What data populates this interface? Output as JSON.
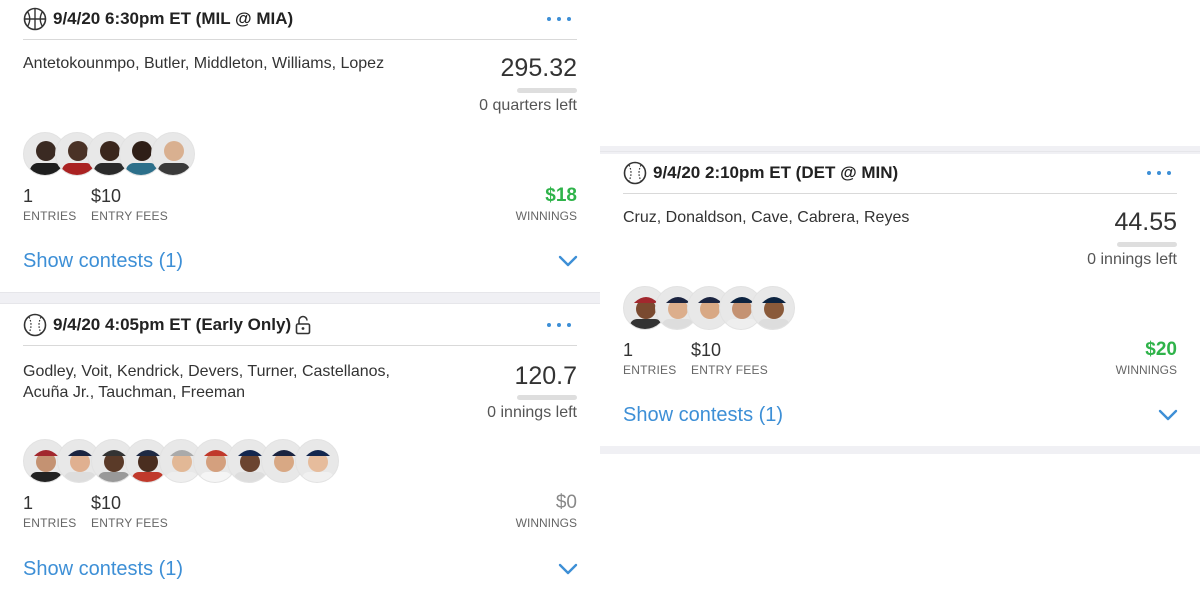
{
  "colors": {
    "accent": "#3d8fd6",
    "win_green": "#2fb34a",
    "zero_gray": "#888888"
  },
  "cards": [
    {
      "sport_icon": "basketball-icon",
      "title": "9/4/20 6:30pm ET (MIL @ MIA)",
      "players": "Antetokounmpo, Butler, Middleton, Williams, Lopez",
      "score": "295.32",
      "remaining": "0 quarters left",
      "entries": "1",
      "entries_label": "ENTRIES",
      "fees": "$10",
      "fees_label": "ENTRY FEES",
      "winnings": "$18",
      "winnings_label": "WINNINGS",
      "show_contests": "Show contests (1)"
    },
    {
      "sport_icon": "baseball-icon",
      "title": "9/4/20 4:05pm ET (Early Only)",
      "players": "Godley, Voit, Kendrick, Devers, Turner, Castellanos, Acuña Jr., Tauchman, Freeman",
      "score": "120.7",
      "remaining": "0 innings left",
      "entries": "1",
      "entries_label": "ENTRIES",
      "fees": "$10",
      "fees_label": "ENTRY FEES",
      "winnings": "$0",
      "winnings_label": "WINNINGS",
      "show_contests": "Show contests (1)"
    },
    {
      "sport_icon": "baseball-icon",
      "title": "9/4/20 2:10pm ET (DET @ MIN)",
      "players": "Cruz, Donaldson, Cave, Cabrera, Reyes",
      "score": "44.55",
      "remaining": "0 innings left",
      "entries": "1",
      "entries_label": "ENTRIES",
      "fees": "$10",
      "fees_label": "ENTRY FEES",
      "winnings": "$20",
      "winnings_label": "WINNINGS",
      "show_contests": "Show contests (1)"
    }
  ]
}
